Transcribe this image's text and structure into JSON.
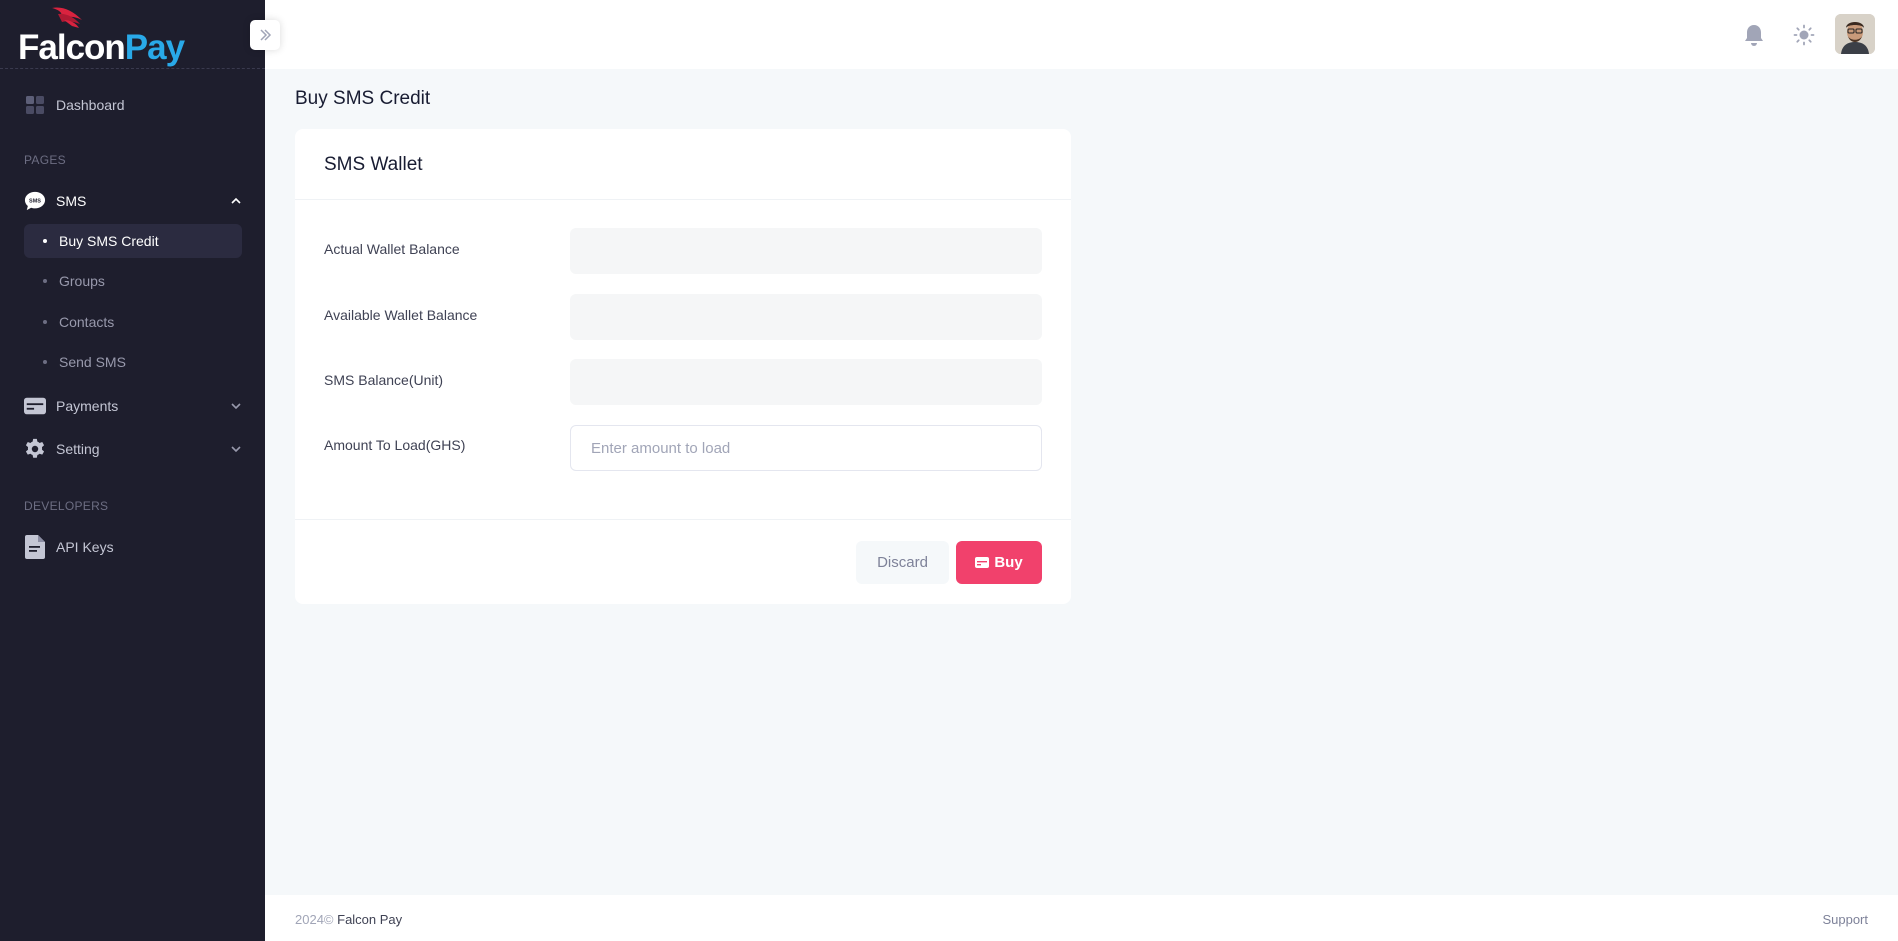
{
  "app": {
    "logo_part1": "Falcon",
    "logo_part2": "Pay"
  },
  "sidebar": {
    "dashboard": "Dashboard",
    "section_pages": "PAGES",
    "sms": "SMS",
    "sms_submenu": [
      "Buy SMS Credit",
      "Groups",
      "Contacts",
      "Send SMS"
    ],
    "active_submenu": "Buy SMS Credit",
    "payments": "Payments",
    "setting": "Setting",
    "section_developers": "DEVELOPERS",
    "api_keys": "API Keys"
  },
  "page": {
    "title": "Buy SMS Credit"
  },
  "card": {
    "title": "SMS Wallet",
    "fields": {
      "actual_wallet_label": "Actual Wallet Balance",
      "available_wallet_label": "Available Wallet Balance",
      "sms_balance_label": "SMS Balance(Unit)",
      "amount_label": "Amount To Load(GHS)",
      "amount_placeholder": "Enter amount to load"
    },
    "discard_label": "Discard",
    "buy_label": "Buy"
  },
  "footer": {
    "year": "2024©",
    "brand": "Falcon Pay",
    "support": "Support"
  },
  "colors": {
    "sidebar_bg": "#1e1e2d",
    "accent": "#f1416c",
    "logo_blue": "#29a9e8",
    "logo_red": "#d9233f"
  }
}
